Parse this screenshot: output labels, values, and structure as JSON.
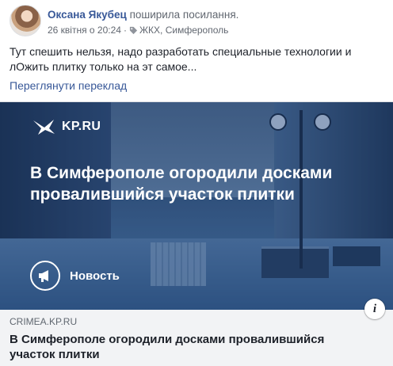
{
  "post": {
    "author": "Оксана Якубец",
    "action": "поширила посилання.",
    "timestamp": "26 квітня о 20:24",
    "separator": "·",
    "tag": "ЖКХ, Симферополь",
    "text": "Тут спешить нельзя, надо разработать специальные технологии и лОжить плитку только на эт самое...",
    "translate_link": "Переглянути переклад"
  },
  "link_preview": {
    "brand": "KP.RU",
    "headline": "В Симферополе огородили досками провалившийся участок плитки",
    "badge": "Новость",
    "info_icon": "i",
    "domain": "CRIMEA.KP.RU",
    "title": "В Симферополе огородили досками провалившийся участок плитки"
  },
  "icons": {
    "tag": "tag-icon",
    "brand": "swallow-logo-icon",
    "badge": "megaphone-icon",
    "info": "info-icon"
  }
}
